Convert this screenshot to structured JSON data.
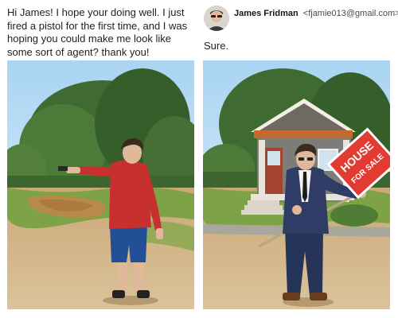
{
  "request": {
    "text": "Hi James! I hope your doing well. I just fired a pistol for the first time, and I was hoping you could make me look like some sort of agent? thank you!"
  },
  "reply": {
    "author_name": "James Fridman",
    "author_email": "<fjamie013@gmail.com>",
    "text": "Sure."
  },
  "sign": {
    "line1": "HOUSE",
    "line2": "FOR SALE"
  },
  "colors": {
    "sign_red": "#e23b32",
    "shirt_red": "#c8302e",
    "suit_navy": "#27345a",
    "grass": "#6f9a3a",
    "sky": "#bfe0f5"
  }
}
